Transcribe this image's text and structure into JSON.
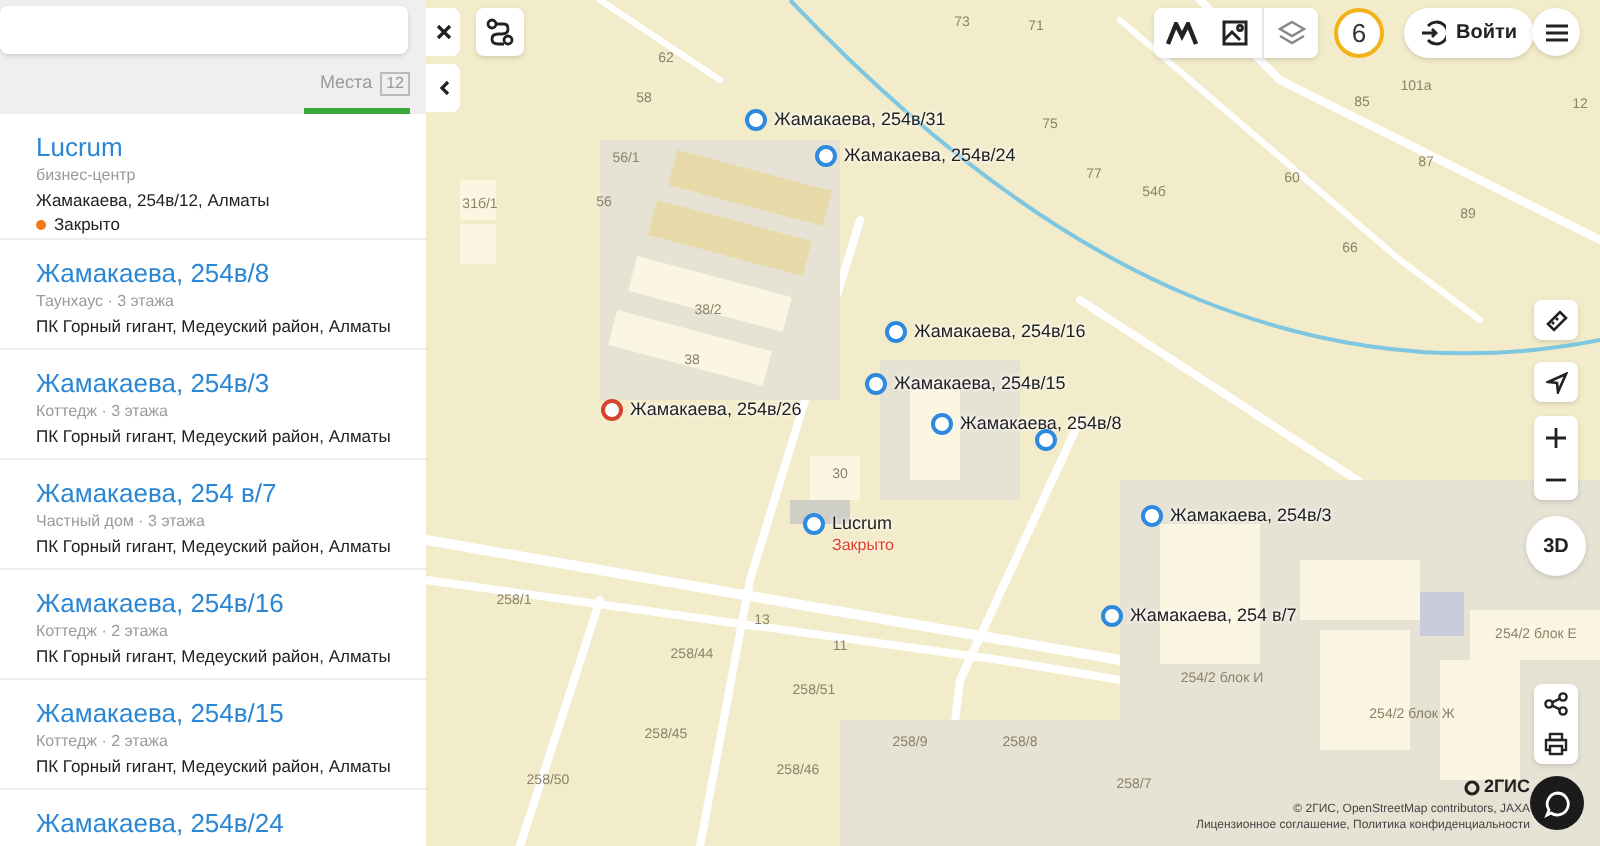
{
  "results_tab": {
    "label": "Места",
    "count": "12",
    "selected": true
  },
  "results": [
    {
      "title": "Lucrum",
      "subtitle": "бизнес-центр",
      "address": "Жамакаева, 254в/12, Алматы",
      "status": "Закрыто"
    },
    {
      "title": "Жамакаева, 254в/8",
      "subtitle": "Таунхаус · 3 этажа",
      "address": "ПК Горный гигант, Медеуский район, Алматы"
    },
    {
      "title": "Жамакаева, 254в/3",
      "subtitle": "Коттедж · 3 этажа",
      "address": "ПК Горный гигант, Медеуский район, Алматы"
    },
    {
      "title": "Жамакаева, 254 в/7",
      "subtitle": "Частный дом · 3 этажа",
      "address": "ПК Горный гигант, Медеуский район, Алматы"
    },
    {
      "title": "Жамакаева, 254в/16",
      "subtitle": "Коттедж · 2 этажа",
      "address": "ПК Горный гигант, Медеуский район, Алматы"
    },
    {
      "title": "Жамакаева, 254в/15",
      "subtitle": "Коттедж · 2 этажа",
      "address": "ПК Горный гигант, Медеуский район, Алматы"
    },
    {
      "title": "Жамакаева, 254в/24"
    }
  ],
  "map": {
    "labels": [
      "62",
      "71",
      "73",
      "75",
      "77",
      "58",
      "56/1",
      "56",
      "31б/1",
      "38/2",
      "38",
      "30",
      "13",
      "11",
      "258/44",
      "258/1",
      "258/45",
      "258/46",
      "258/50",
      "258/51",
      "258/9",
      "258/8",
      "258/7",
      "85",
      "101а",
      "87",
      "89",
      "54б",
      "60",
      "66",
      "12",
      "254/2 блок Е",
      "254/2 блок И",
      "254/2 блок Ж"
    ],
    "pins": [
      {
        "label": "Жамакаева, 254в/31",
        "selected": false
      },
      {
        "label": "Жамакаева, 254в/24",
        "selected": false
      },
      {
        "label": "Жамакаева, 254в/16",
        "selected": false
      },
      {
        "label": "Жамакаева, 254в/15",
        "selected": false
      },
      {
        "label": "Жамакаева, 254в/8",
        "selected": false
      },
      {
        "selected": false
      },
      {
        "label": "Жамакаева, 254в/26",
        "selected": true
      },
      {
        "label": "Lucrum",
        "status": "Закрыто",
        "selected": false
      },
      {
        "label": "Жамакаева, 254в/3",
        "selected": false
      },
      {
        "label": "Жамакаева, 254 в/7",
        "selected": false
      }
    ]
  },
  "controls": {
    "counter": "6",
    "login": "Войти",
    "view_3d": "3D"
  },
  "attribution": {
    "logo": "2ГИС",
    "copyright": "© 2ГИС, OpenStreetMap contributors, JAXA",
    "links": "Лицензионное соглашение, Политика конфиденциальности"
  }
}
